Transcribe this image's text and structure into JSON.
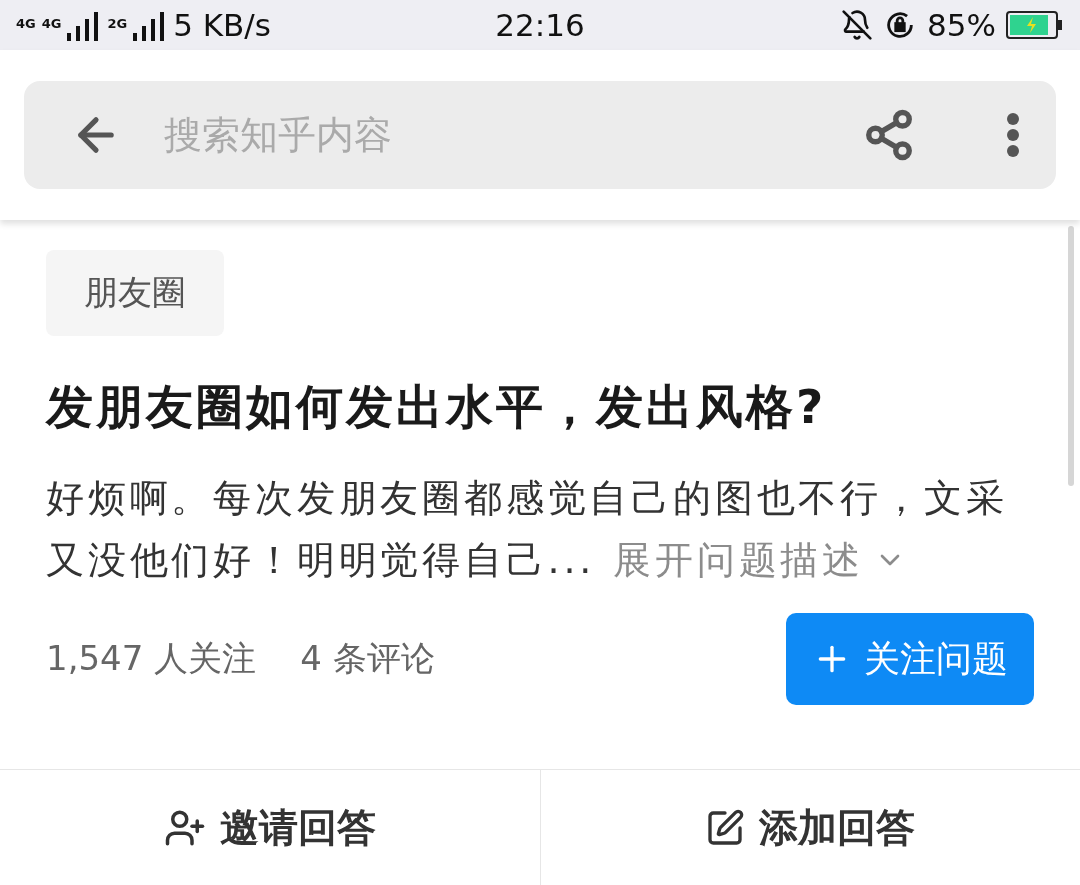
{
  "status_bar": {
    "sim1_label": "4G",
    "sim1_sub": "4G",
    "sim2_label": "2G",
    "speed": "5 KB/s",
    "time": "22:16",
    "battery": "85%"
  },
  "search": {
    "placeholder": "搜索知乎内容"
  },
  "question": {
    "topic": "朋友圈",
    "title": "发朋友圈如何发出水平，发出风格?",
    "description": "好烦啊。每次发朋友圈都感觉自己的图也不行，文采又没他们好！明明觉得自己...",
    "expand_link": "展开问题描述",
    "followers": "1,547 人关注",
    "comments": "4 条评论",
    "follow_button": "关注问题"
  },
  "actions": [
    {
      "kind": "invite",
      "label": "邀请回答"
    },
    {
      "kind": "answer",
      "label": "添加回答"
    }
  ]
}
